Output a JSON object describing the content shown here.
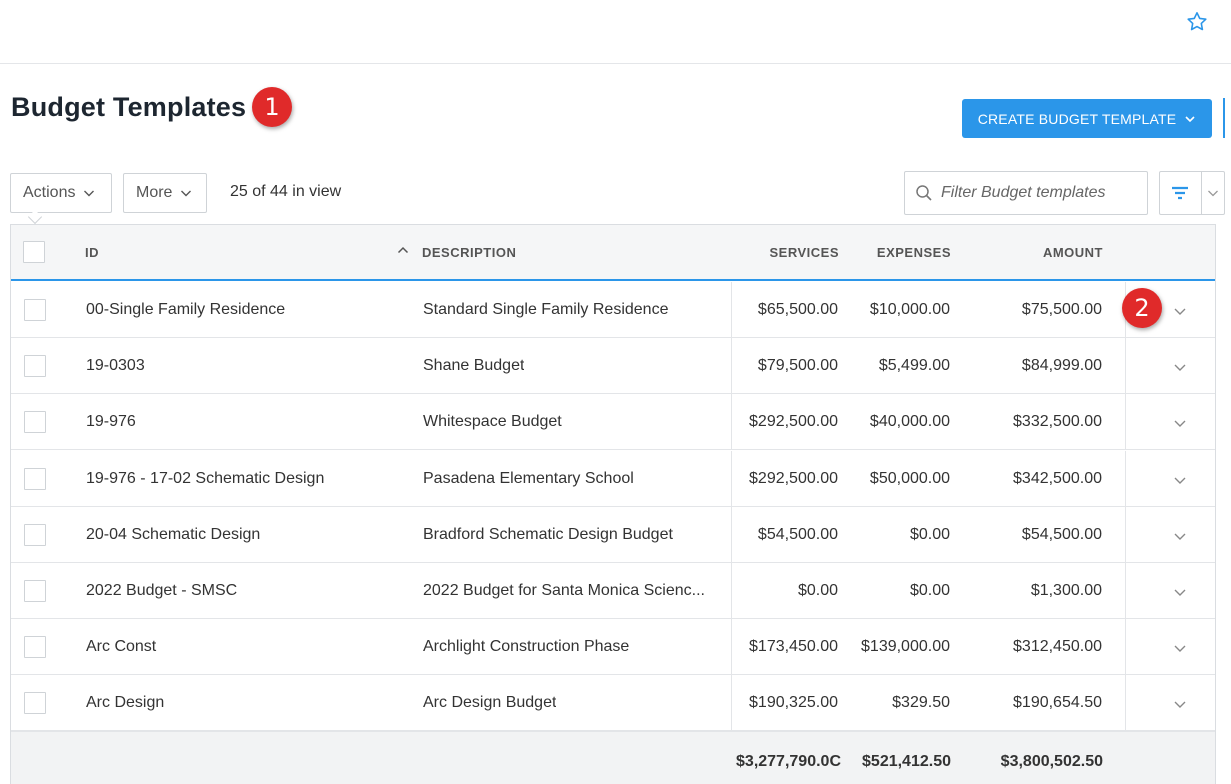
{
  "page": {
    "title": "Budget Templates",
    "create_button": "CREATE BUDGET TEMPLATE",
    "markers": [
      "1",
      "2"
    ]
  },
  "toolbar": {
    "actions_label": "Actions",
    "more_label": "More",
    "count_text": "25 of 44 in view",
    "filter_placeholder": "Filter Budget templates"
  },
  "table": {
    "columns": {
      "id": "ID",
      "description": "DESCRIPTION",
      "services": "SERVICES",
      "expenses": "EXPENSES",
      "amount": "AMOUNT"
    },
    "rows": [
      {
        "id": "00-Single Family Residence",
        "description": "Standard Single Family Residence",
        "services": "$65,500.00",
        "expenses": "$10,000.00",
        "amount": "$75,500.00"
      },
      {
        "id": "19-0303",
        "description": "Shane Budget",
        "services": "$79,500.00",
        "expenses": "$5,499.00",
        "amount": "$84,999.00"
      },
      {
        "id": "19-976",
        "description": "Whitespace Budget",
        "services": "$292,500.00",
        "expenses": "$40,000.00",
        "amount": "$332,500.00"
      },
      {
        "id": "19-976 - 17-02 Schematic Design",
        "description": "Pasadena Elementary School",
        "services": "$292,500.00",
        "expenses": "$50,000.00",
        "amount": "$342,500.00"
      },
      {
        "id": "20-04 Schematic Design",
        "description": "Bradford Schematic Design Budget",
        "services": "$54,500.00",
        "expenses": "$0.00",
        "amount": "$54,500.00"
      },
      {
        "id": "2022 Budget - SMSC",
        "description": "2022 Budget for Santa Monica Scienc...",
        "services": "$0.00",
        "expenses": "$0.00",
        "amount": "$1,300.00"
      },
      {
        "id": "Arc Const",
        "description": "Archlight Construction Phase",
        "services": "$173,450.00",
        "expenses": "$139,000.00",
        "amount": "$312,450.00"
      },
      {
        "id": "Arc Design",
        "description": "Arc Design Budget",
        "services": "$190,325.00",
        "expenses": "$329.50",
        "amount": "$190,654.50"
      }
    ],
    "totals": {
      "services": "$3,277,790.0C",
      "expenses": "$521,412.50",
      "amount": "$3,800,502.50"
    }
  },
  "colors": {
    "accent": "#2b96e9",
    "marker": "#e02a2a"
  },
  "icons": [
    "star-icon",
    "chevron-down-icon",
    "search-icon",
    "filter-icon"
  ]
}
